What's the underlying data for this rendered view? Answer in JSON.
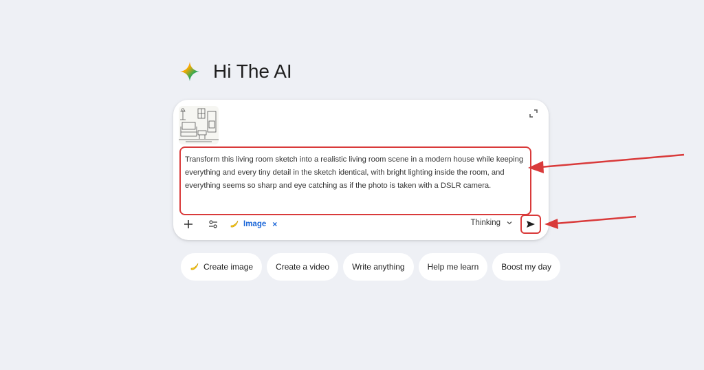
{
  "greeting": {
    "text": "Hi The AI",
    "icon": "gemini-spark-icon"
  },
  "composer": {
    "attachment": {
      "icon": "living-room-sketch-thumbnail"
    },
    "prompt_text": "Transform this living room sketch into a realistic living room scene in a modern house while keeping everything and every tiny detail in the sketch identical, with bright lighting inside the room, and everything seems so sharp and eye catching as if the photo is taken with a DSLR camera.",
    "toolbar": {
      "add_icon": "plus-icon",
      "tools_icon": "sliders-icon",
      "image_chip": {
        "label": "Image",
        "icon": "banana-icon",
        "remove_symbol": "×"
      },
      "mode_label": "Thinking",
      "send_icon": "send-arrow-icon"
    }
  },
  "suggestions": [
    {
      "label": "Create image",
      "icon": "banana-icon"
    },
    {
      "label": "Create a video"
    },
    {
      "label": "Write anything"
    },
    {
      "label": "Help me learn"
    },
    {
      "label": "Boost my day"
    }
  ],
  "colors": {
    "background": "#eef0f5",
    "highlight_red": "#d93a3a",
    "link_blue": "#1a66d8",
    "card": "#ffffff"
  }
}
